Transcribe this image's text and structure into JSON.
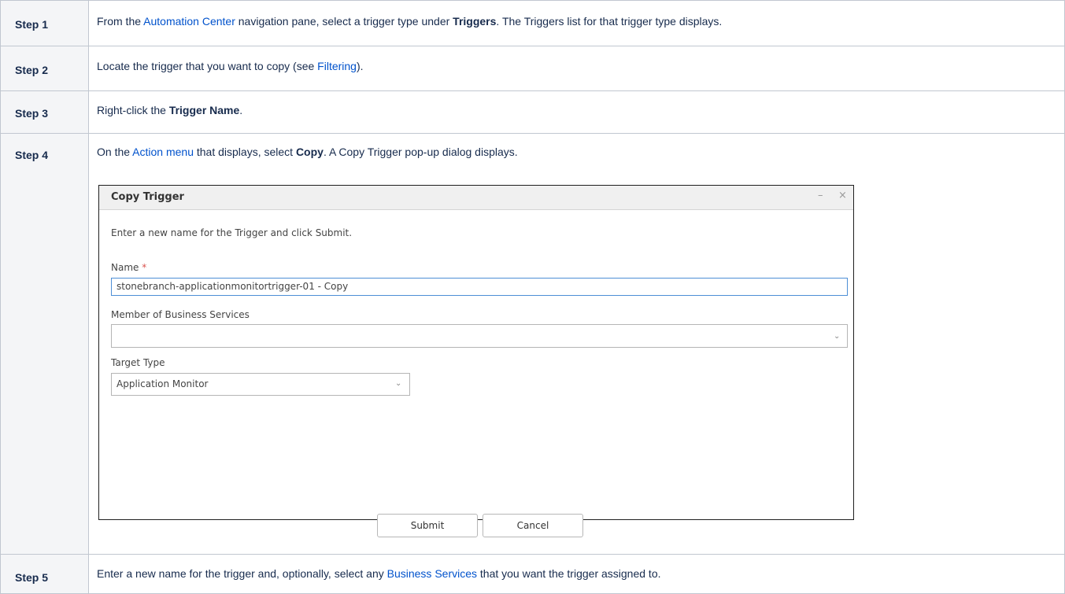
{
  "steps": [
    {
      "label": "Step 1",
      "parts": [
        {
          "t": "From the ",
          "k": "text"
        },
        {
          "t": "Automation Center",
          "k": "link"
        },
        {
          "t": " navigation pane, select a trigger type under ",
          "k": "text"
        },
        {
          "t": "Triggers",
          "k": "bold"
        },
        {
          "t": ". The Triggers list for that trigger type displays.",
          "k": "text"
        }
      ]
    },
    {
      "label": "Step 2",
      "parts": [
        {
          "t": "Locate the trigger that you want to copy (see ",
          "k": "text"
        },
        {
          "t": "Filtering",
          "k": "link"
        },
        {
          "t": ").",
          "k": "text"
        }
      ]
    },
    {
      "label": "Step 3",
      "parts": [
        {
          "t": "Right-click the ",
          "k": "text"
        },
        {
          "t": "Trigger Name",
          "k": "bold"
        },
        {
          "t": ".",
          "k": "text"
        }
      ]
    },
    {
      "label": "Step 4",
      "parts": [
        {
          "t": "On the ",
          "k": "text"
        },
        {
          "t": "Action menu",
          "k": "link"
        },
        {
          "t": " that displays, select ",
          "k": "text"
        },
        {
          "t": "Copy",
          "k": "bold"
        },
        {
          "t": ". A Copy Trigger pop-up dialog displays.",
          "k": "text"
        }
      ]
    },
    {
      "label": "Step 5",
      "parts": [
        {
          "t": "Enter a new name for the trigger and, optionally, select any ",
          "k": "text"
        },
        {
          "t": "Business Services",
          "k": "link"
        },
        {
          "t": " that you want the trigger assigned to.",
          "k": "text"
        }
      ]
    }
  ],
  "dialog": {
    "title": "Copy Trigger",
    "minimize_glyph": "–",
    "close_glyph": "×",
    "instruction": "Enter a new name for the Trigger and click Submit.",
    "name_label": "Name",
    "required_mark": "*",
    "name_value": "stonebranch-applicationmonitortrigger-01 - Copy",
    "business_services_label": "Member of Business Services",
    "business_services_value": "",
    "target_type_label": "Target Type",
    "target_type_value": "Application Monitor",
    "submit_label": "Submit",
    "cancel_label": "Cancel"
  },
  "colors": {
    "link": "#0052cc",
    "label_bg": "#f4f5f7",
    "border": "#c1c7d0",
    "focus_border": "#4d8fd6",
    "required": "#d9534f"
  },
  "icons": [
    "chevron-down-icon",
    "minimize-icon",
    "close-icon"
  ]
}
